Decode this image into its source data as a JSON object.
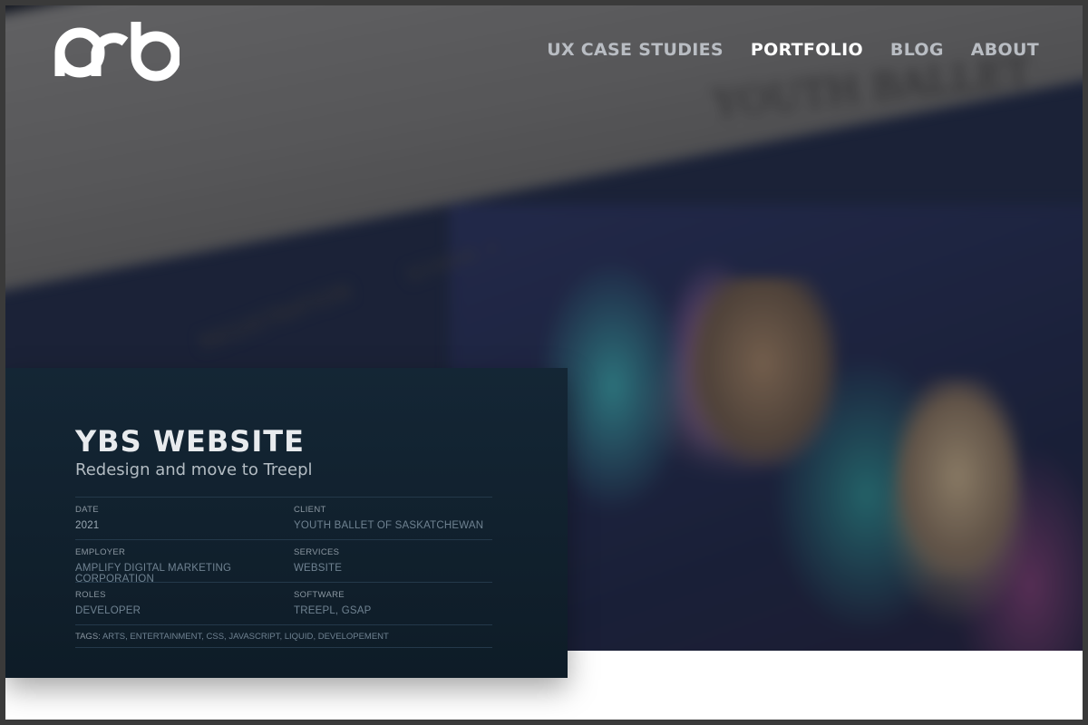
{
  "nav": {
    "logo_alt": "drb",
    "items": [
      {
        "label": "UX CASE STUDIES",
        "active": false
      },
      {
        "label": "PORTFOLIO",
        "active": true
      },
      {
        "label": "BLOG",
        "active": false
      },
      {
        "label": "ABOUT",
        "active": false
      }
    ]
  },
  "hero": {
    "screenshot_text": {
      "brand": "YOUTH BALLET",
      "menu_1": "REGISTRATION",
      "menu_2": "SCHOOL +"
    }
  },
  "project": {
    "title": "YBS WEBSITE",
    "subtitle": "Redesign and move to Treepl",
    "meta": [
      [
        {
          "label": "DATE",
          "value": "2021"
        },
        {
          "label": "CLIENT",
          "value": "YOUTH BALLET OF SASKATCHEWAN"
        }
      ],
      [
        {
          "label": "EMPLOYER",
          "value": "AMPLIFY DIGITAL MARKETING CORPORATION"
        },
        {
          "label": "SERVICES",
          "value": "WEBSITE"
        }
      ],
      [
        {
          "label": "ROLES",
          "value": "DEVELOPER"
        },
        {
          "label": "SOFTWARE",
          "value": "TREEPL, GSAP"
        }
      ]
    ],
    "tags_label": "TAGS:",
    "tags": [
      "ARTS",
      "ENTERTAINMENT",
      "CSS",
      "JAVASCRIPT",
      "LIQUID",
      "DEVELOPEMENT"
    ]
  },
  "colors": {
    "panel_bg": "#142635",
    "nav_active": "#ffffff",
    "nav_inactive": "#b9bdc3"
  }
}
